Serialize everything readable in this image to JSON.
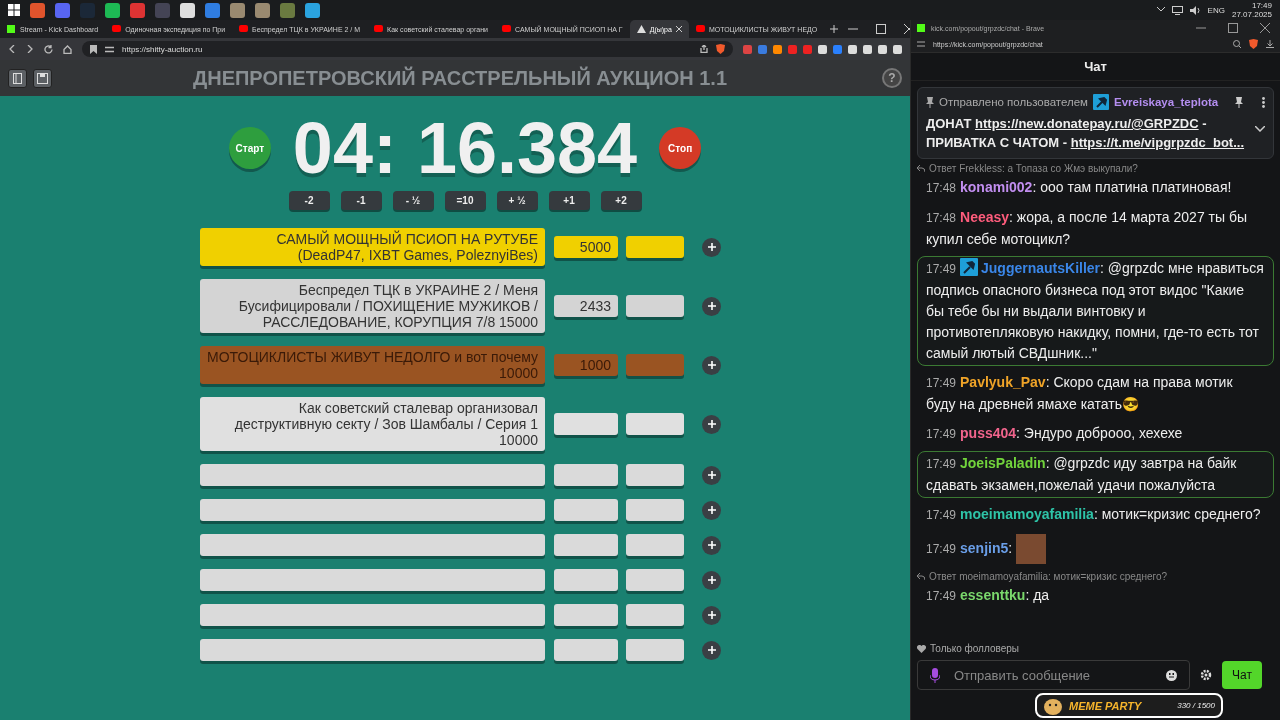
{
  "taskbar": {
    "apps": [
      {
        "color": "#e0542c"
      },
      {
        "color": "#5865f2"
      },
      {
        "color": "#1b2838"
      },
      {
        "color": "#1db954"
      },
      {
        "color": "#d33"
      },
      {
        "color": "#445"
      },
      {
        "color": "#ddd"
      },
      {
        "color": "#2f7de1"
      },
      {
        "color": "#9a8a70"
      },
      {
        "color": "#9a8a70"
      },
      {
        "color": "#6a7a40"
      },
      {
        "color": "#2aa3df"
      }
    ],
    "language": "ENG",
    "time": "17:49",
    "date": "27.07.2025"
  },
  "browser": {
    "tabs": [
      {
        "label": "Stream - Kick Dashboard",
        "kind": "kick",
        "selected": false
      },
      {
        "label": "Одиночная экспедиция по При",
        "kind": "video",
        "selected": false
      },
      {
        "label": "Беспредел ТЦК в УКРАИНЕ 2 / М",
        "kind": "video",
        "selected": false
      },
      {
        "label": "Как советский сталевар органи",
        "kind": "video",
        "selected": false
      },
      {
        "label": "САМЫЙ МОЩНЫЙ ПСИОП НА Г",
        "kind": "video",
        "selected": false
      },
      {
        "label": "Д(ы)ра",
        "kind": "site",
        "selected": true
      },
      {
        "label": "МОТОЦИКЛИСТЫ ЖИВУТ НЕДО",
        "kind": "video",
        "selected": false
      }
    ],
    "url": "https://shitty-auction.ru"
  },
  "auction": {
    "title": "ДНЕПРОПЕТРОВСКИЙ РАССТРЕЛЬНЫЙ АУКЦИОН 1.1",
    "help": "?",
    "start": "Старт",
    "timer": "04: 16.384",
    "stop": "Стоп",
    "adjust": [
      "-2",
      "-1",
      "- ½",
      "=10",
      "+ ½",
      "+1",
      "+2"
    ],
    "lots": [
      {
        "title": "САМЫЙ МОЩНЫЙ ПСИОП НА РУТУБЕ (DeadP47, IXBT Games, PoleznyiBes)",
        "amount": "5000",
        "color": "#f0d000"
      },
      {
        "title": "Беспредел ТЦК в УКРАИНЕ 2 / Меня Бусифицировали / ПОХИЩЕНИЕ МУЖИКОВ / РАССЛЕДОВАНИЕ, КОРУПЦИЯ 7/8 15000",
        "amount": "2433",
        "color": "#d4d4d4"
      },
      {
        "title": "МОТОЦИКЛИСТЫ ЖИВУТ НЕДОЛГО и вот почему 10000",
        "amount": "1000",
        "color": "#9a5422"
      },
      {
        "title": "Как советский сталевар организовал деструктивную секту / Зов Шамбалы / Серия 1 10000",
        "color": "#e0e0e0"
      },
      {
        "color": "#dadada"
      },
      {
        "color": "#dadada"
      },
      {
        "color": "#dadada"
      },
      {
        "color": "#dadada"
      },
      {
        "color": "#dadada"
      },
      {
        "color": "#dadada"
      }
    ]
  },
  "chat": {
    "window_title": "kick.com/popout/grpzdc/chat - Brave",
    "url": "https://kick.com/popout/grpzdc/chat",
    "header": "Чат",
    "pinned": {
      "label": "Отправлено пользователем",
      "user": "Evreiskaya_teplota",
      "parts": [
        {
          "kind": "text",
          "text": "ДОНАТ "
        },
        {
          "kind": "link",
          "text": "https://new.donatepay.ru/@GRPZDC"
        },
        {
          "kind": "text",
          "text": " - ПРИВАТКА С ЧАТОМ - "
        },
        {
          "kind": "link",
          "text": "https://t.me/vipgrpzdc_bot..."
        }
      ]
    },
    "messages": [
      {
        "reply": "Ответ Frekkless: а Топаза со Жмэ выкупали?",
        "time": "17:48",
        "user": "konami002",
        "color": "#c28ef0",
        "text": ": ооо там платина платиновая!",
        "highlighted": false,
        "badge": false,
        "emote": false
      },
      {
        "time": "17:48",
        "user": "Neeasy",
        "color": "#ff5c7c",
        "text": ": жора, а после 14 марта 2027 ты бы купил себе мотоцикл?",
        "highlighted": false,
        "badge": false,
        "emote": false
      },
      {
        "time": "17:49",
        "user": "JuggernautsKiller",
        "color": "#3a86e8",
        "text": ": @grpzdc мне нравиться подпись опасного бизнеса под этот видос \"Какие бы тебе бы ни выдали винтовку и противотепляковую накидку, помни, где-то есть тот самый лютый СВДшник...\"",
        "highlighted": true,
        "badge": true,
        "emote": false
      },
      {
        "time": "17:49",
        "user": "Pavlyuk_Pav",
        "color": "#f0a428",
        "text": ": Скоро сдам на права мотик буду на древней ямахе катать😎",
        "highlighted": false,
        "badge": false,
        "emote": false
      },
      {
        "time": "17:49",
        "user": "puss404",
        "color": "#f0648c",
        "text": ": Эндуро доброоо, хехехе",
        "highlighted": false,
        "badge": false,
        "emote": false
      },
      {
        "time": "17:49",
        "user": "JoeisPaladin",
        "color": "#72d43c",
        "text": ": @grpzdc иду завтра на байк сдавать экзамен,пожелай удачи пожалуйста",
        "highlighted": true,
        "badge": false,
        "emote": false
      },
      {
        "time": "17:49",
        "user": "moeimamoyafamilia",
        "color": "#2ec4a8",
        "text": ": мотик=кризис среднего?",
        "highlighted": false,
        "badge": false,
        "emote": false
      },
      {
        "time": "17:49",
        "user": "senjin5",
        "color": "#6a9ee8",
        "text": ":",
        "highlighted": false,
        "badge": false,
        "emote": true
      },
      {
        "reply": "Ответ moeimamoyafamilia: мотик=кризис среднего?",
        "time": "17:49",
        "user": "essenttku",
        "color": "#7ad86c",
        "text": ": да",
        "highlighted": false,
        "badge": false,
        "emote": false
      }
    ],
    "followers_only": "Только фолловеры",
    "input": {
      "placeholder": "Отправить сообщение"
    },
    "send": "Чат",
    "meme": {
      "title": "MEME PARTY",
      "progress": "330 / 1500"
    }
  }
}
